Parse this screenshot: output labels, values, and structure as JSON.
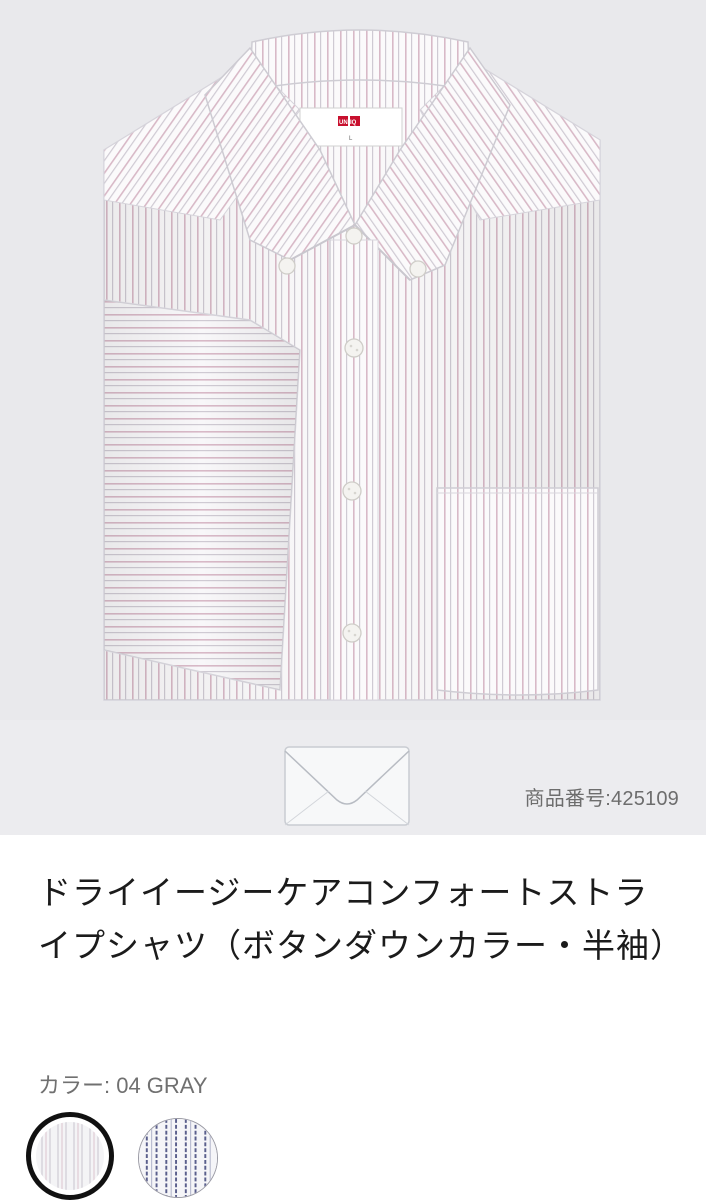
{
  "product": {
    "code_text": "商品番号:425109",
    "title": "ドライイージーケアコンフォートストライプシャツ（ボタンダウンカラー・半袖）",
    "color_text": "カラー: 04 GRAY"
  },
  "gallery": {
    "thumbnail_icon": "envelope-icon",
    "label_brand": "UNIQLO",
    "label_size": "L"
  },
  "colors": {
    "background": "#e9e9ec",
    "stripe_pink": "#d9b6c5",
    "stripe_gray": "#c9c6cf",
    "selected_ring": "#111111",
    "navy_stripe": "#5a5f8c"
  },
  "swatches": [
    {
      "name": "gray-stripe",
      "selected": true
    },
    {
      "name": "navy-stripe",
      "selected": false
    }
  ]
}
